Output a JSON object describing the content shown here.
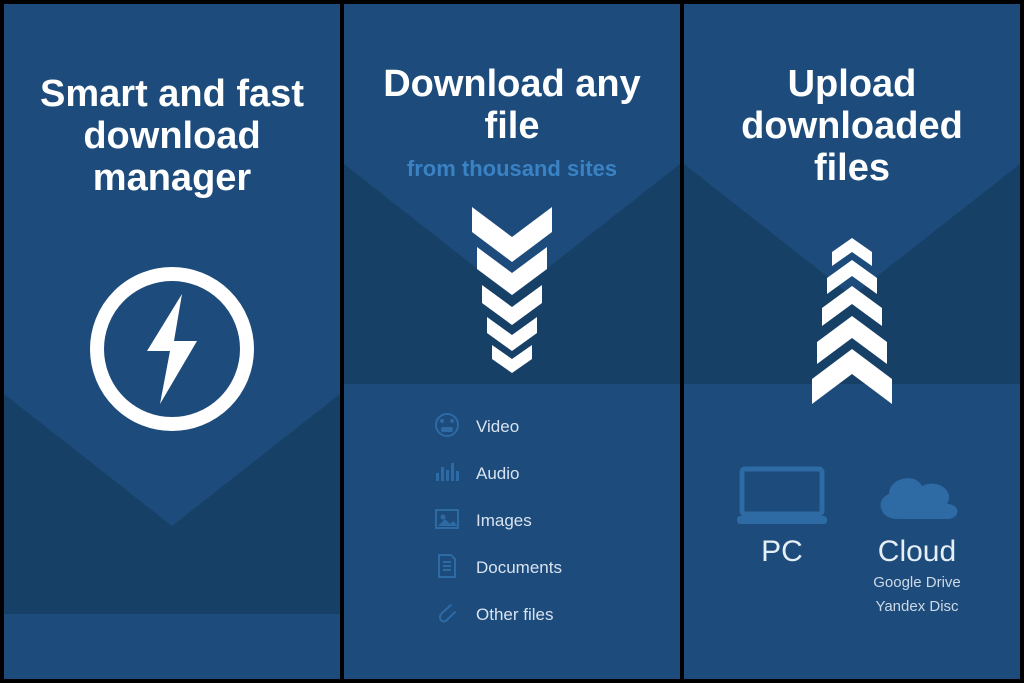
{
  "panel1": {
    "heading": "Smart and fast download manager"
  },
  "panel2": {
    "heading": "Download any file",
    "sub": "from thousand sites",
    "list": {
      "0": {
        "label": "Video"
      },
      "1": {
        "label": "Audio"
      },
      "2": {
        "label": "Images"
      },
      "3": {
        "label": "Documents"
      },
      "4": {
        "label": "Other files"
      }
    }
  },
  "panel3": {
    "heading": "Upload downloaded files",
    "targets": {
      "pc": {
        "label": "PC"
      },
      "cloud": {
        "label": "Cloud",
        "sub1": "Google Drive",
        "sub2": "Yandex Disc"
      }
    }
  },
  "colors": {
    "bg_light": "#1c4b7c",
    "bg_dark": "#174066",
    "accent": "#3b82c4",
    "icon_dim": "#2e6aa3"
  }
}
